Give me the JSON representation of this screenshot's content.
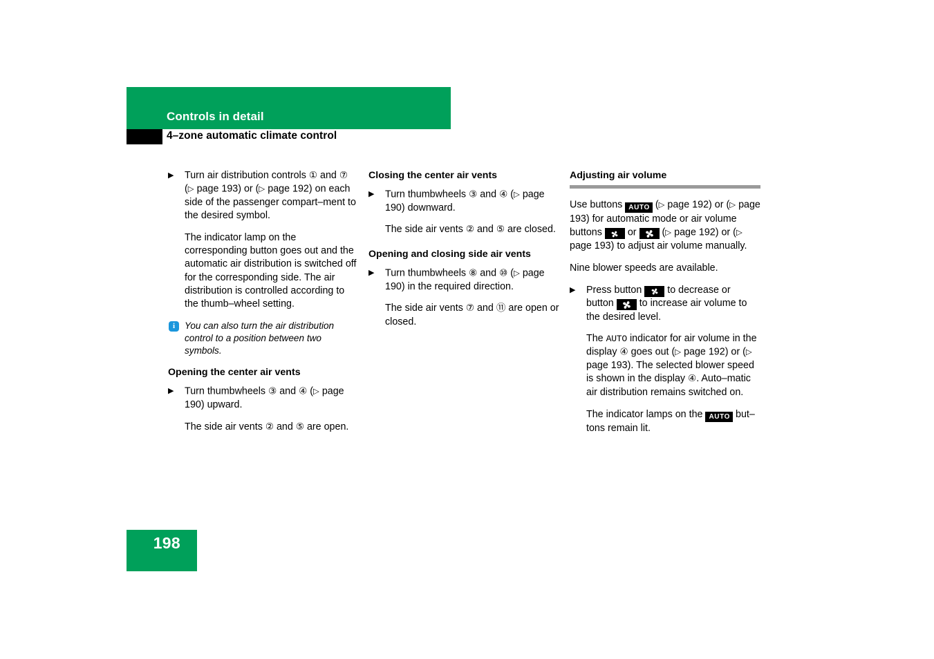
{
  "header": {
    "band_title": "Controls in detail",
    "section_title": "4–zone automatic climate control",
    "band_color": "#00a05a",
    "marker_color": "#000000"
  },
  "columns": {
    "col1": {
      "step1": {
        "marker": "▶",
        "text_a": "Turn air distribution controls ",
        "num_1": "①",
        "text_b": " and ",
        "num_7": "⑦",
        "text_c": " (",
        "ref_tri_1": "▷",
        "text_d": " page 193) or (",
        "ref_tri_2": "▷",
        "text_e": " page 192) on each side of the passenger compart–ment to the desired symbol."
      },
      "para1": "The indicator lamp on the corresponding button goes out and the automatic air distribution is switched off for the corresponding side. The air distribution is controlled according to the thumb–wheel setting.",
      "note": {
        "icon": "i",
        "text": "You can also turn the air distribution control to a position between two symbols."
      },
      "heading": "Opening the center air vents",
      "step2": {
        "marker": "▶",
        "text_a": "Turn thumbwheels ",
        "num_3": "③",
        "text_b": " and ",
        "num_4": "④",
        "text_c": " (",
        "ref_tri": "▷",
        "text_d": " page 190) upward."
      },
      "result": {
        "text_a": "The side air vents ",
        "num_2": "②",
        "text_b": " and ",
        "num_5": "⑤",
        "text_c": " are open."
      }
    },
    "col2": {
      "heading1": "Closing the center air vents",
      "step1": {
        "marker": "▶",
        "text_a": "Turn thumbwheels ",
        "num_3": "③",
        "text_b": " and ",
        "num_4": "④",
        "text_c": " (",
        "ref_tri": "▷",
        "text_d": " page 190) downward."
      },
      "result1": {
        "text_a": "The side air vents ",
        "num_2": "②",
        "text_b": " and ",
        "num_5": "⑤",
        "text_c": " are closed."
      },
      "heading2": "Opening and closing side air vents",
      "step2": {
        "marker": "▶",
        "text_a": "Turn thumbwheels ",
        "num_8": "⑧",
        "text_b": " and ",
        "num_10": "⑩",
        "text_c": " (",
        "ref_tri": "▷",
        "text_d": " page 190) in the required direction."
      },
      "result2": {
        "text_a": "The side air vents ",
        "num_7": "⑦",
        "text_b": " and ",
        "num_11": "⑪",
        "text_c": " are open or closed."
      }
    },
    "col3": {
      "heading": "Adjusting air volume",
      "rule_color": "#9a9a9a",
      "para1": {
        "text_a": "Use buttons ",
        "badge_auto": "AUTO",
        "text_b": " (",
        "ref_tri_1": "▷",
        "text_c": " page 192) or (",
        "ref_tri_2": "▷",
        "text_d": " page 193) for automatic mode or air volume buttons ",
        "text_e": " or ",
        "text_f": " (",
        "ref_tri_3": "▷",
        "text_g": " page 192) or (",
        "ref_tri_4": "▷",
        "text_h": " page 193) to adjust air volume manually."
      },
      "para2": "Nine blower speeds are available.",
      "step1": {
        "marker": "▶",
        "text_a": "Press button ",
        "text_b": " to decrease or button ",
        "text_c": " to increase air volume to the desired level."
      },
      "result1": {
        "text_a": "The ",
        "mono_auto": "AUTO",
        "text_b": " indicator for air volume in the display ",
        "num_4a": "④",
        "text_c": " goes out (",
        "ref_tri_1": "▷",
        "text_d": " page 192) or (",
        "ref_tri_2": "▷",
        "text_e": " page 193). The selected blower speed is shown in the display ",
        "num_4b": "④",
        "text_f": ". Auto–matic air distribution remains switched on."
      },
      "result2": {
        "text_a": "The indicator lamps on the ",
        "badge_auto": "AUTO",
        "text_b": " but–tons remain lit."
      }
    }
  },
  "footer": {
    "page_number": "198",
    "background": "#00a05a"
  }
}
